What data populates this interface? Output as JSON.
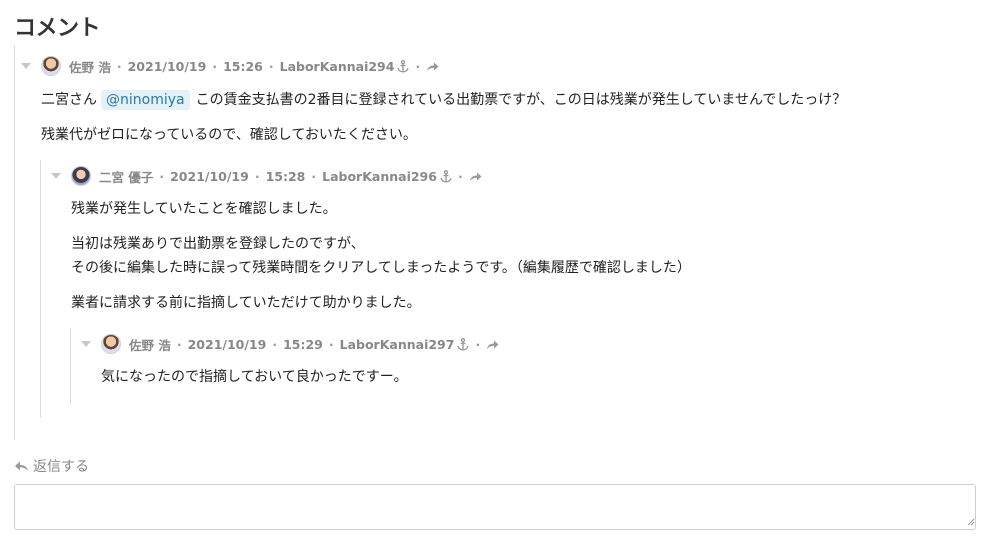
{
  "section": {
    "title": "コメント"
  },
  "comments": [
    {
      "author": "佐野 浩",
      "date": "2021/10/19",
      "time": "15:26",
      "anchor": "LaborKannai294",
      "avatar": "man-avatar",
      "line1": {
        "prefix": "二宮さん",
        "mention": "@ninomiya",
        "suffix": "この賃金支払書の2番目に登録されている出勤票ですが、この日は残業が発生していませんでしたっけ？"
      },
      "line2": "残業代がゼロになっているので、確認しておいたください。"
    },
    {
      "author": "二宮 優子",
      "date": "2021/10/19",
      "time": "15:28",
      "anchor": "LaborKannai296",
      "avatar": "woman-avatar",
      "p1": "残業が発生していたことを確認しました。",
      "p2a": "当初は残業ありで出勤票を登録したのですが、",
      "p2b": "その後に編集した時に誤って残業時間をクリアしてしまったようです。（編集履歴で確認しました）",
      "p3": "業者に請求する前に指摘していただけて助かりました。"
    },
    {
      "author": "佐野 浩",
      "date": "2021/10/19",
      "time": "15:29",
      "anchor": "LaborKannai297",
      "avatar": "man-avatar",
      "p1": "気になったので指摘しておいて良かったですー。"
    }
  ],
  "meta_separator": "·",
  "reply": {
    "label": "返信する",
    "value": ""
  }
}
